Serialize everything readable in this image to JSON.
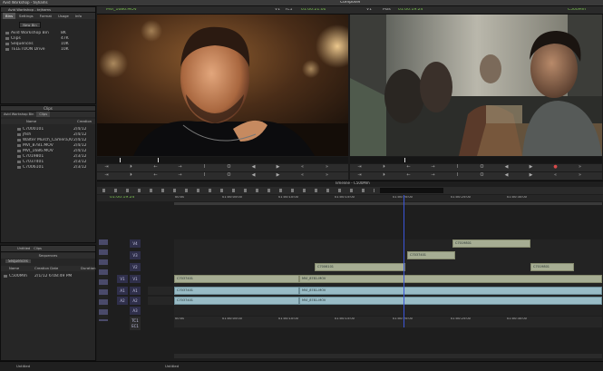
{
  "title_bar": {
    "left": "Avid Workshop - tejhams",
    "center": "Composer"
  },
  "project": {
    "window_title": "Avid Workshop - tejhams",
    "tabs": [
      "Bins",
      "Settings",
      "Format",
      "Usage",
      "Info"
    ],
    "new_bin_label": "New Bin",
    "items": [
      {
        "name": "Avid Workshop Bin",
        "count": "8K"
      },
      {
        "name": "Clips",
        "count": "47K"
      },
      {
        "name": "Sequences",
        "count": "10K"
      },
      {
        "name": "TELETOON Drive",
        "count": "10K"
      }
    ]
  },
  "clips_bin": {
    "title": "Clips",
    "tabs": [
      "Avid Workshop Bin",
      "Clips"
    ],
    "columns": [
      "Name",
      "Creation"
    ],
    "rows": [
      {
        "name": "C7000101",
        "date": "2/4/12"
      },
      {
        "name": "jfish",
        "date": "2/4/12"
      },
      {
        "name": "Walter Murch_Camera,Knowl",
        "date": "2/4/12"
      },
      {
        "name": "MVI_8781.MOV",
        "date": "2/4/12"
      },
      {
        "name": "MVI_1686.MOV",
        "date": "2/4/12"
      },
      {
        "name": "C7019801",
        "date": "2/3/12"
      },
      {
        "name": "C7037401",
        "date": "2/3/12"
      },
      {
        "name": "C7006101",
        "date": "2/3/12"
      }
    ]
  },
  "sequences_bin": {
    "title": "Sequences",
    "tabs": [
      "Untitled",
      "Clips"
    ],
    "tab_label": "Sequences",
    "columns": [
      "Name",
      "Creation Date",
      "Duration"
    ],
    "rows": [
      {
        "name": "C500Mm",
        "date": "2/1/12 6:08:49 PM"
      }
    ]
  },
  "source_monitor": {
    "clip": "MVI_1686.MOV",
    "track": "V1",
    "tc_label": "TC1",
    "timecode": "01:00:21:00"
  },
  "record_monitor": {
    "track": "V1",
    "label": "Mas",
    "timecode": "01:00:19:24",
    "sequence": "C500Mm"
  },
  "source_controls_1": [
    "⇥",
    "⏵",
    "←",
    "→",
    "I",
    "O",
    "◀",
    "▶",
    "«",
    "»"
  ],
  "source_controls_2": [
    "⇥",
    "⏵",
    "←",
    "→",
    "I",
    "O",
    "◀",
    "▶",
    "«",
    "»"
  ],
  "record_controls_1": [
    "⇥",
    "⏵",
    "←",
    "→",
    "I",
    "O",
    "◀",
    "▶",
    "●",
    "»"
  ],
  "record_controls_2": [
    "⇥",
    "⏵",
    "←",
    "→",
    "I",
    "O",
    "◀",
    "▶",
    "«",
    "»"
  ],
  "timeline": {
    "title": "Timeline - C500Mm",
    "timecode": "01:00:19:24",
    "ruler_top": [
      "00:00",
      "01:00:05:00",
      "01:00:10:00",
      "01:00:15:00",
      "01:00:20:00",
      "01:00:25:00",
      "01:00:30:00"
    ],
    "ruler_bottom": [
      "00:00",
      "01:00:05:00",
      "01:00:10:00",
      "01:00:15:00",
      "01:00:20:00",
      "01:00:25:00",
      "01:00:30:00"
    ],
    "tracks": [
      "V4",
      "V3",
      "V2",
      "V1",
      "A1",
      "A2",
      "A3",
      "TC1",
      "EC1"
    ],
    "source_tracks": [
      "V1",
      "A1",
      "A2"
    ],
    "clips": {
      "v4": "C7019801",
      "v3": "C7037401",
      "v2a": "C7006101",
      "v2b": "C7019801",
      "v1a": "C7037401",
      "v1b": "MVI_8781.MOV",
      "a1a": "C7037401",
      "a1b": "MVI_8781.MOV",
      "a2a": "C7037401",
      "a2b": "MVI_8781.MOV"
    },
    "bottom_left": "Untitled",
    "bottom_mid": "Untitled"
  }
}
